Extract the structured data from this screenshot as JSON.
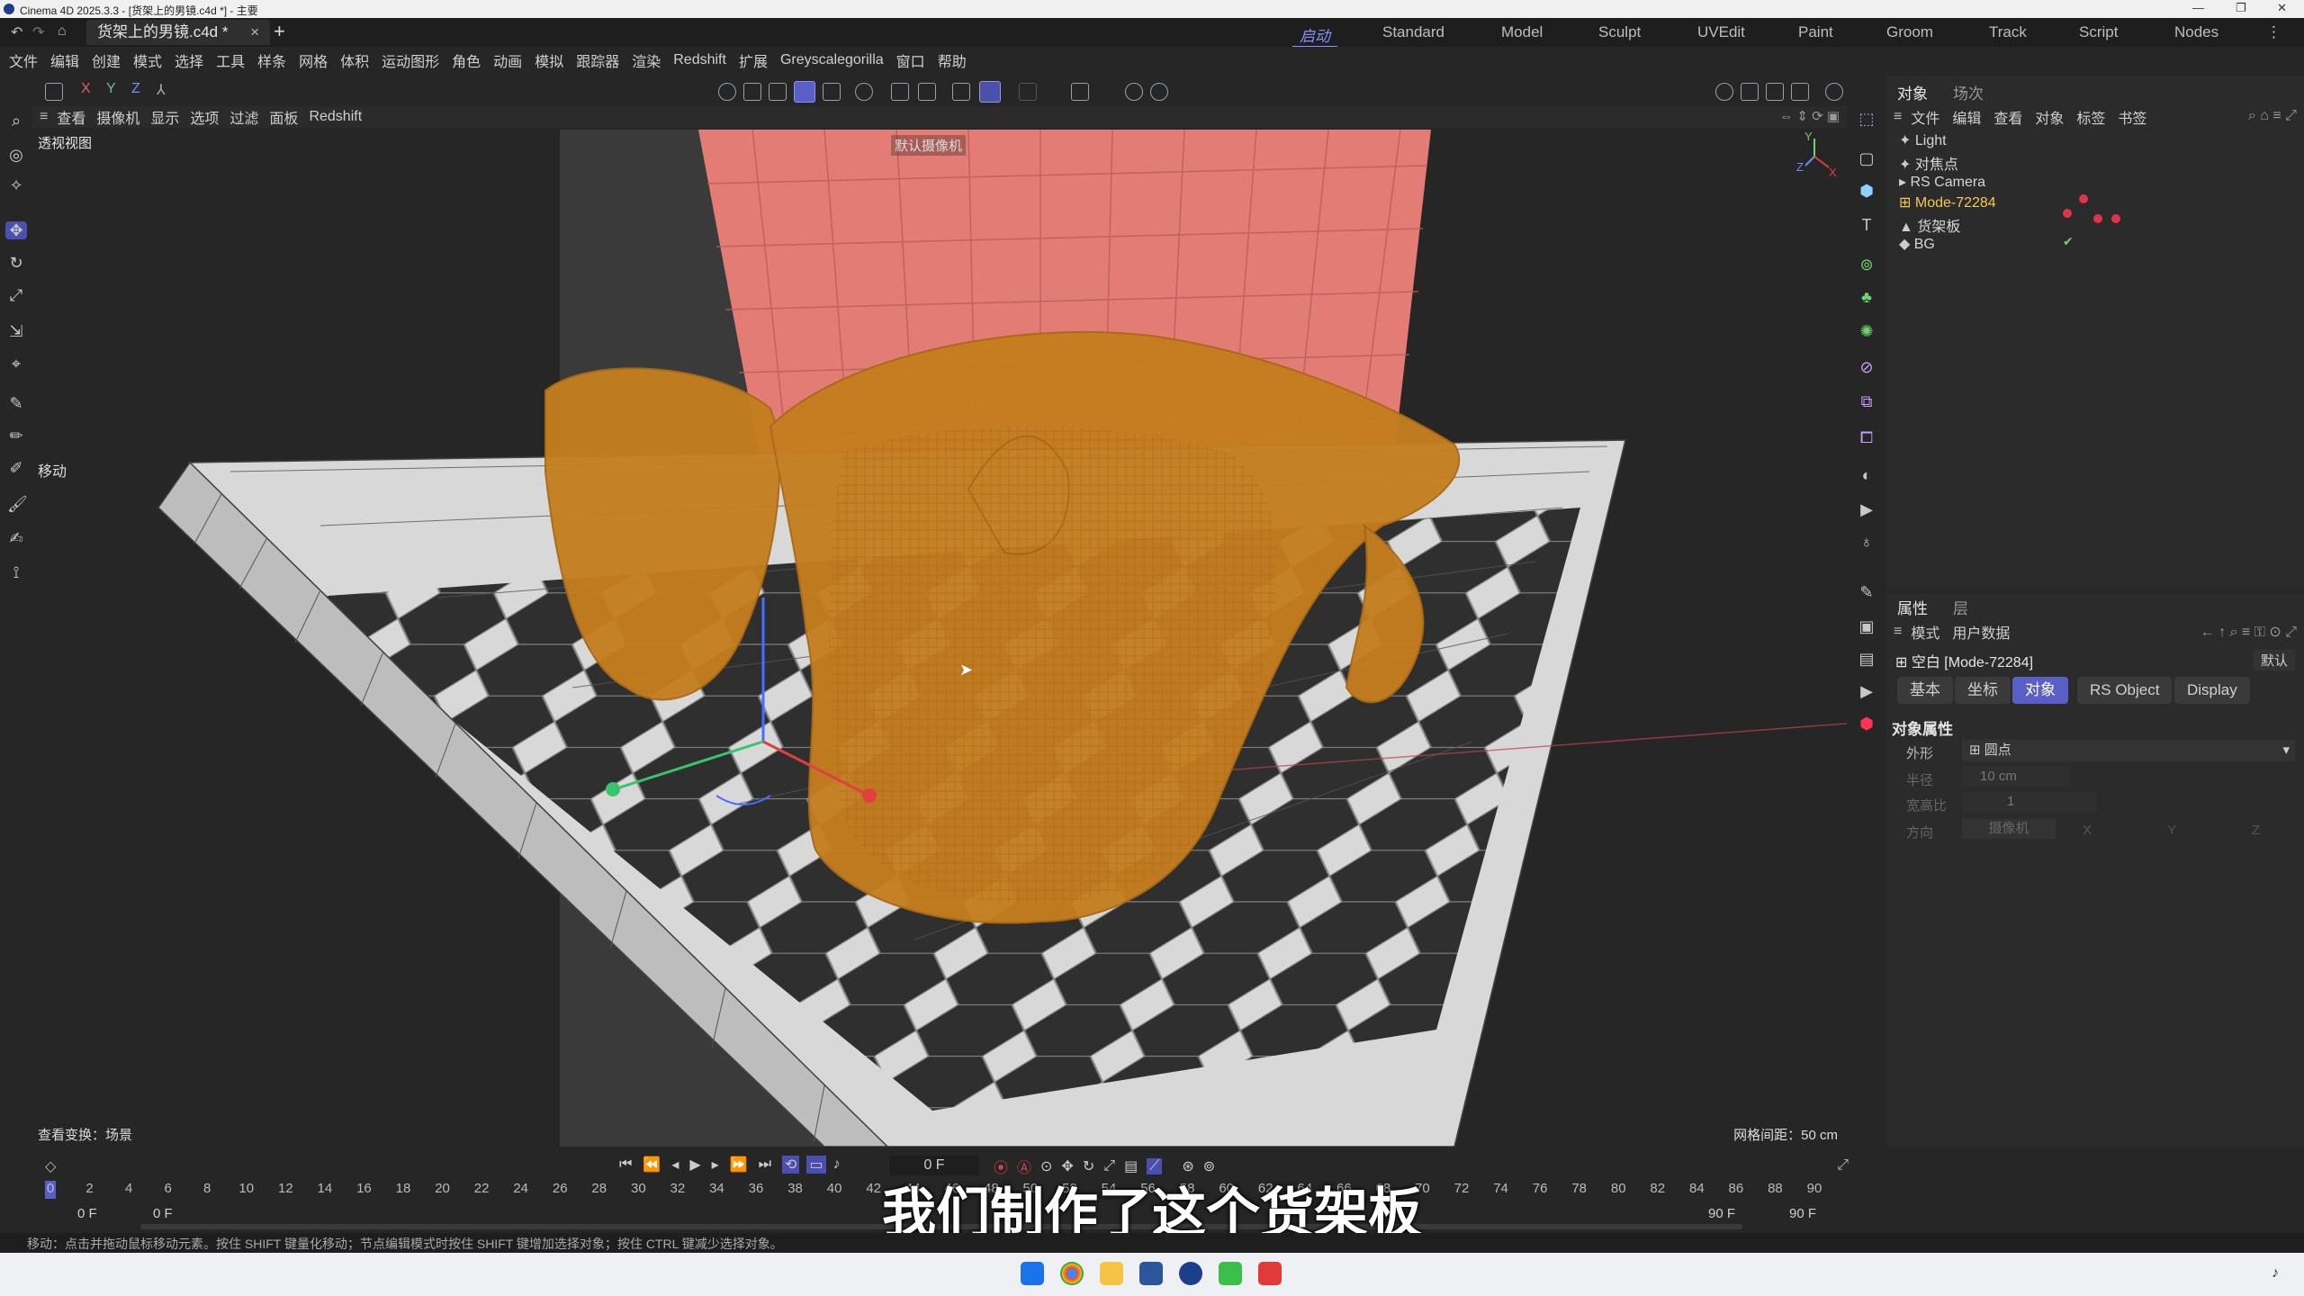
{
  "window": {
    "title": "Cinema 4D 2025.3.3 - [货架上的男镜.c4d *] - 主要"
  },
  "tabs": {
    "doc": "货架上的男镜.c4d *",
    "close": "×",
    "add": "+"
  },
  "layouts": [
    "启动",
    "Standard",
    "Model",
    "Sculpt",
    "UVEdit",
    "Paint",
    "Groom",
    "Track",
    "Script",
    "Nodes"
  ],
  "menu": [
    "文件",
    "编辑",
    "创建",
    "模式",
    "选择",
    "工具",
    "样条",
    "网格",
    "体积",
    "运动图形",
    "角色",
    "动画",
    "模拟",
    "跟踪器",
    "渲染",
    "Redshift",
    "扩展",
    "Greyscalegorilla",
    "窗口",
    "帮助"
  ],
  "axis_toggles": [
    "X",
    "Y",
    "Z"
  ],
  "viewport": {
    "menu": [
      "查看",
      "摄像机",
      "显示",
      "选项",
      "过滤",
      "面板",
      "Redshift"
    ],
    "name": "透视视图",
    "camera": "默认摄像机",
    "move_label": "移动",
    "view_transform": "查看变换：场景",
    "grid_spacing": "网格间距：50 cm",
    "axis_y": "Y",
    "axis_x": "X",
    "axis_z": "Z"
  },
  "object_manager": {
    "tabs": [
      "对象",
      "场次"
    ],
    "menu": [
      "文件",
      "编辑",
      "查看",
      "对象",
      "标签",
      "书签"
    ],
    "objects": [
      "Light",
      "对焦点",
      "RS Camera",
      "Mode-72284",
      "货架板",
      "BG"
    ],
    "selected": "Mode-72284"
  },
  "attributes": {
    "tabs": [
      "属性",
      "层"
    ],
    "menu": [
      "模式",
      "用户数据"
    ],
    "object_title": "空白 [Mode-72284]",
    "preset": "默认",
    "sub_tabs": [
      "基本",
      "坐标",
      "对象",
      "RS Object",
      "Display"
    ],
    "active_sub_tab": "对象",
    "section": "对象属性",
    "fields": [
      {
        "label": "外形",
        "value": "圆点"
      },
      {
        "label": "半径",
        "value": "10 cm"
      },
      {
        "label": "宽高比",
        "value": "1"
      },
      {
        "label": "方向",
        "value": "摄像机"
      }
    ],
    "xyz": [
      "X",
      "Y",
      "Z"
    ]
  },
  "timeline": {
    "current_frame": "0 F",
    "ticks": [
      "0",
      "2",
      "4",
      "6",
      "8",
      "10",
      "12",
      "14",
      "16",
      "18",
      "20",
      "22",
      "24",
      "26",
      "28",
      "30",
      "32",
      "34",
      "36",
      "38",
      "40",
      "42",
      "44",
      "46",
      "48",
      "50",
      "52",
      "54",
      "56",
      "58",
      "60",
      "62",
      "64",
      "66",
      "68",
      "70",
      "72",
      "74",
      "76",
      "78",
      "80",
      "82",
      "84",
      "86",
      "88",
      "90"
    ],
    "start_a": "0 F",
    "start_b": "0 F",
    "end_a": "90 F",
    "end_b": "90 F"
  },
  "status": "移动：点击并拖动鼠标移动元素。按住 SHIFT 键量化移动；节点编辑模式时按住 SHIFT 键增加选择对象；按住 CTRL 键减少选择对象。",
  "subtitle": "我们制作了这个货架板",
  "colors": {
    "accent": "#5a5fc7",
    "selected_object": "#f2c94c",
    "glasses": "#c57e1f",
    "backdrop": "#e27c74"
  }
}
